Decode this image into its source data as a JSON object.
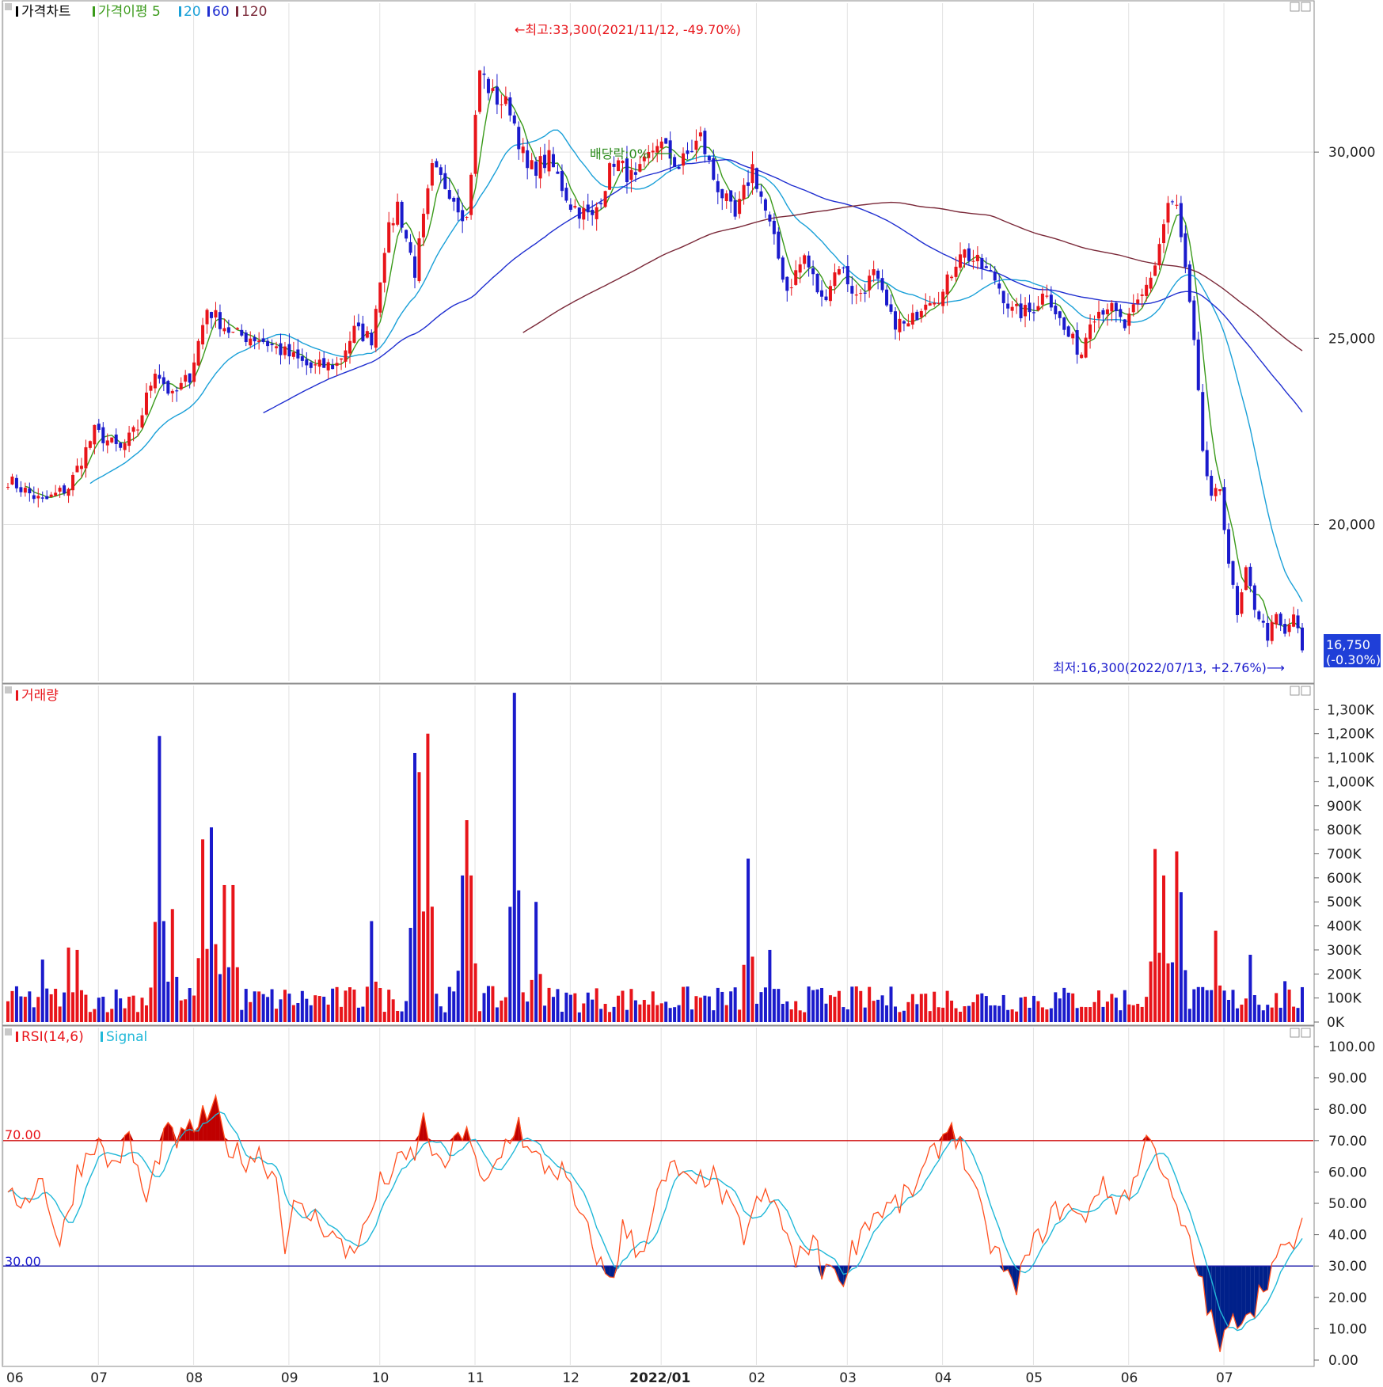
{
  "price_panel": {
    "legend": {
      "price_chart_label": "가격차트",
      "ma_label": "가격이평 5",
      "ma20": "20",
      "ma60": "60",
      "ma120": "120"
    },
    "high_annotation": "←최고:33,300(2021/11/12, -49.70%)",
    "low_annotation": "최저:16,300(2022/07/13, +2.76%)⟶",
    "dividend_annotation": "배당락:0%",
    "last_price": "16,750",
    "last_change": "(-0.30%)",
    "y_ticks": [
      "30,000",
      "25,000",
      "20,000"
    ],
    "colors": {
      "up": "#e8141a",
      "down": "#1a1acc",
      "ma5": "#3a9a1a",
      "ma20": "#1aa0d8",
      "ma60": "#1f2ed0",
      "ma120": "#7a2838"
    }
  },
  "volume_panel": {
    "title": "거래량",
    "y_ticks": [
      "1,300K",
      "1,200K",
      "1,100K",
      "1,000K",
      "900K",
      "800K",
      "700K",
      "600K",
      "500K",
      "400K",
      "300K",
      "200K",
      "100K",
      "0K"
    ]
  },
  "rsi_panel": {
    "title": "RSI(14,6)",
    "signal_label": "Signal",
    "line70_label": "70.00",
    "line30_label": "30.00",
    "y_ticks": [
      "100.00",
      "90.00",
      "80.00",
      "70.00",
      "60.00",
      "50.00",
      "40.00",
      "30.00",
      "20.00",
      "10.00",
      "0.00"
    ],
    "colors": {
      "rsi": "#ff5020",
      "signal": "#20b8d8",
      "over": "#c00000",
      "under": "#00208a"
    }
  },
  "x_axis": {
    "months": [
      "06",
      "07",
      "08",
      "09",
      "10",
      "11",
      "12",
      "2022/01",
      "02",
      "03",
      "04",
      "05",
      "06",
      "07"
    ]
  },
  "chart_data": [
    {
      "type": "candlestick",
      "title": "가격차트",
      "ylim": [
        15800,
        34000
      ],
      "anchors": [
        [
          0,
          21200
        ],
        [
          8,
          20600
        ],
        [
          14,
          21000
        ],
        [
          20,
          22500
        ],
        [
          26,
          22000
        ],
        [
          30,
          22600
        ],
        [
          34,
          24200
        ],
        [
          38,
          23400
        ],
        [
          42,
          24000
        ],
        [
          46,
          25800
        ],
        [
          52,
          25100
        ],
        [
          58,
          25000
        ],
        [
          64,
          24600
        ],
        [
          70,
          24200
        ],
        [
          76,
          24300
        ],
        [
          80,
          25200
        ],
        [
          84,
          25000
        ],
        [
          87,
          27500
        ],
        [
          90,
          28600
        ],
        [
          94,
          26800
        ],
        [
          98,
          29500
        ],
        [
          102,
          29000
        ],
        [
          106,
          28200
        ],
        [
          109,
          32200
        ],
        [
          112,
          31500
        ],
        [
          116,
          31200
        ],
        [
          120,
          29500
        ],
        [
          125,
          29800
        ],
        [
          130,
          28600
        ],
        [
          135,
          28200
        ],
        [
          140,
          29800
        ],
        [
          145,
          29200
        ],
        [
          150,
          30300
        ],
        [
          155,
          29600
        ],
        [
          160,
          30400
        ],
        [
          163,
          29300
        ],
        [
          168,
          28200
        ],
        [
          172,
          29600
        ],
        [
          176,
          28000
        ],
        [
          180,
          26300
        ],
        [
          184,
          27200
        ],
        [
          188,
          26000
        ],
        [
          192,
          27000
        ],
        [
          196,
          26100
        ],
        [
          200,
          26700
        ],
        [
          204,
          25500
        ],
        [
          208,
          25300
        ],
        [
          212,
          26100
        ],
        [
          216,
          26200
        ],
        [
          220,
          27400
        ],
        [
          224,
          27000
        ],
        [
          228,
          26600
        ],
        [
          232,
          25700
        ],
        [
          236,
          25700
        ],
        [
          240,
          26300
        ],
        [
          244,
          25200
        ],
        [
          248,
          24600
        ],
        [
          250,
          25600
        ],
        [
          254,
          25900
        ],
        [
          258,
          25300
        ],
        [
          262,
          26100
        ],
        [
          265,
          27000
        ],
        [
          268,
          28600
        ],
        [
          270,
          28500
        ],
        [
          272,
          26800
        ],
        [
          274,
          24800
        ],
        [
          276,
          22000
        ],
        [
          278,
          20600
        ],
        [
          280,
          21000
        ],
        [
          282,
          19000
        ],
        [
          284,
          17500
        ],
        [
          286,
          18700
        ],
        [
          288,
          17800
        ],
        [
          291,
          17000
        ],
        [
          293,
          17500
        ],
        [
          295,
          17000
        ],
        [
          297,
          17600
        ],
        [
          299,
          16600
        ]
      ],
      "high": {
        "value": 33300,
        "date": "2021/11/12"
      },
      "low": {
        "value": 16300,
        "date": "2022/07/13"
      },
      "last": 16750
    },
    {
      "type": "bar",
      "title": "거래량",
      "ylim": [
        0,
        1400
      ],
      "unit": "K",
      "spikes": [
        [
          8,
          260
        ],
        [
          14,
          310
        ],
        [
          16,
          300
        ],
        [
          34,
          410
        ],
        [
          35,
          1190
        ],
        [
          36,
          420
        ],
        [
          38,
          470
        ],
        [
          45,
          760
        ],
        [
          47,
          810
        ],
        [
          50,
          570
        ],
        [
          52,
          570
        ],
        [
          84,
          420
        ],
        [
          94,
          1120
        ],
        [
          95,
          1040
        ],
        [
          96,
          460
        ],
        [
          97,
          1200
        ],
        [
          105,
          610
        ],
        [
          106,
          840
        ],
        [
          107,
          610
        ],
        [
          117,
          1370
        ],
        [
          122,
          500
        ],
        [
          171,
          680
        ],
        [
          176,
          300
        ],
        [
          265,
          720
        ],
        [
          267,
          610
        ],
        [
          270,
          710
        ],
        [
          271,
          540
        ],
        [
          279,
          380
        ],
        [
          287,
          280
        ],
        [
          295,
          170
        ]
      ]
    },
    {
      "type": "line",
      "title": "RSI(14,6)",
      "series": [
        {
          "name": "RSI(14,6)"
        },
        {
          "name": "Signal"
        }
      ],
      "ylim": [
        0,
        100
      ],
      "anchors": [
        [
          0,
          50
        ],
        [
          4,
          52
        ],
        [
          8,
          58
        ],
        [
          12,
          36
        ],
        [
          16,
          60
        ],
        [
          20,
          70
        ],
        [
          24,
          62
        ],
        [
          28,
          70
        ],
        [
          32,
          50
        ],
        [
          36,
          72
        ],
        [
          40,
          70
        ],
        [
          44,
          76
        ],
        [
          48,
          80
        ],
        [
          50,
          70
        ],
        [
          54,
          64
        ],
        [
          58,
          66
        ],
        [
          62,
          58
        ],
        [
          64,
          38
        ],
        [
          66,
          48
        ],
        [
          70,
          46
        ],
        [
          74,
          42
        ],
        [
          78,
          34
        ],
        [
          82,
          40
        ],
        [
          86,
          56
        ],
        [
          90,
          62
        ],
        [
          94,
          66
        ],
        [
          96,
          76
        ],
        [
          98,
          68
        ],
        [
          100,
          60
        ],
        [
          104,
          70
        ],
        [
          106,
          76
        ],
        [
          108,
          62
        ],
        [
          110,
          54
        ],
        [
          112,
          60
        ],
        [
          116,
          72
        ],
        [
          118,
          76
        ],
        [
          120,
          66
        ],
        [
          124,
          62
        ],
        [
          128,
          60
        ],
        [
          132,
          46
        ],
        [
          136,
          34
        ],
        [
          138,
          26
        ],
        [
          140,
          28
        ],
        [
          142,
          42
        ],
        [
          146,
          34
        ],
        [
          150,
          52
        ],
        [
          154,
          62
        ],
        [
          158,
          54
        ],
        [
          162,
          60
        ],
        [
          166,
          50
        ],
        [
          170,
          40
        ],
        [
          174,
          52
        ],
        [
          178,
          48
        ],
        [
          182,
          30
        ],
        [
          186,
          40
        ],
        [
          188,
          28
        ],
        [
          190,
          34
        ],
        [
          192,
          22
        ],
        [
          194,
          32
        ],
        [
          198,
          44
        ],
        [
          202,
          48
        ],
        [
          206,
          50
        ],
        [
          210,
          56
        ],
        [
          214,
          66
        ],
        [
          218,
          76
        ],
        [
          222,
          60
        ],
        [
          226,
          40
        ],
        [
          230,
          30
        ],
        [
          232,
          22
        ],
        [
          236,
          34
        ],
        [
          240,
          44
        ],
        [
          244,
          50
        ],
        [
          248,
          44
        ],
        [
          252,
          56
        ],
        [
          256,
          50
        ],
        [
          260,
          56
        ],
        [
          264,
          74
        ],
        [
          268,
          54
        ],
        [
          272,
          40
        ],
        [
          276,
          24
        ],
        [
          278,
          12
        ],
        [
          280,
          4
        ],
        [
          284,
          14
        ],
        [
          288,
          18
        ],
        [
          292,
          30
        ],
        [
          296,
          36
        ],
        [
          299,
          42
        ]
      ]
    }
  ]
}
